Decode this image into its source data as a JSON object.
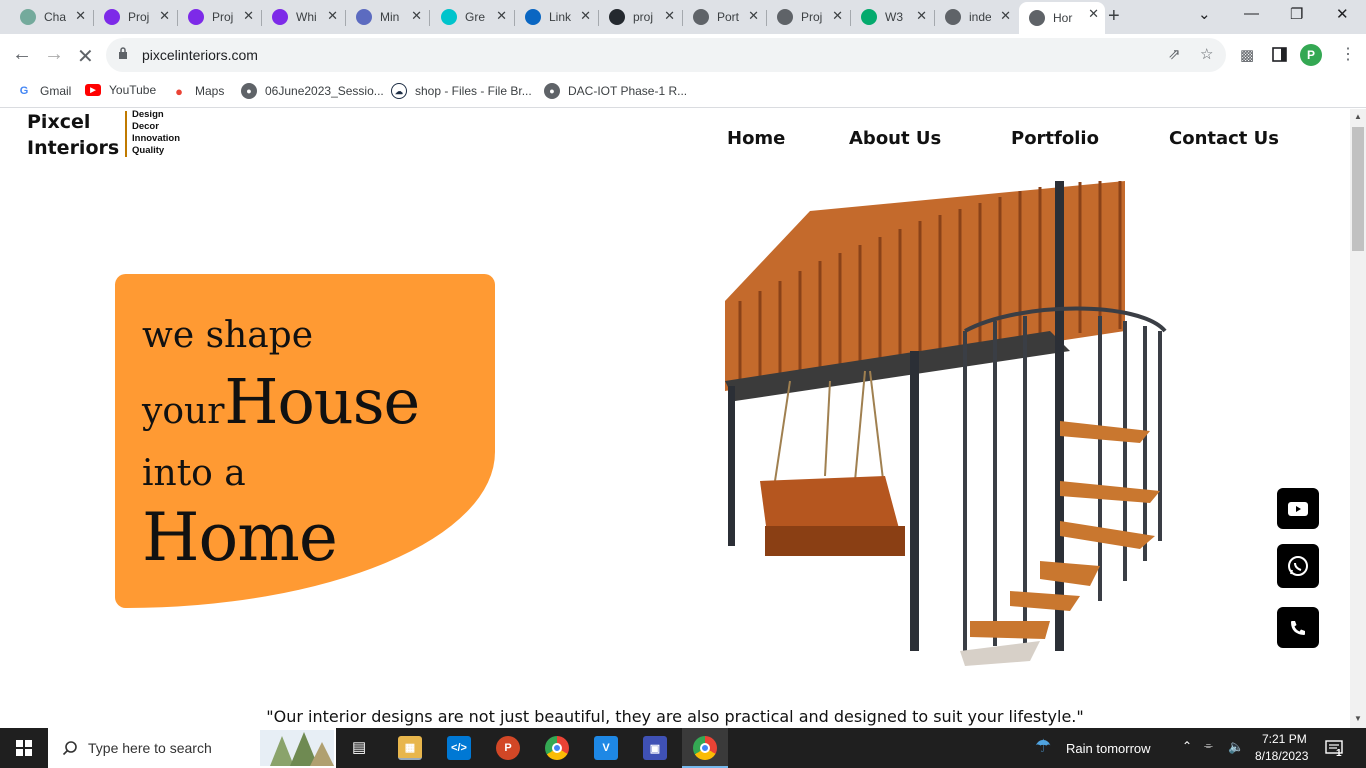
{
  "browser": {
    "tabs": [
      {
        "label": "Cha",
        "icon": "chatgpt-icon",
        "color": "#74aa9c"
      },
      {
        "label": "Proj",
        "icon": "canva-icon",
        "color": "#7d2ae8"
      },
      {
        "label": "Proj",
        "icon": "canva-icon",
        "color": "#7d2ae8"
      },
      {
        "label": "Whi",
        "icon": "canva-icon",
        "color": "#7d2ae8"
      },
      {
        "label": "Min",
        "icon": "printer-icon",
        "color": "#5c6bc0"
      },
      {
        "label": "Gre",
        "icon": "canva-icon",
        "color": "#00c4cc"
      },
      {
        "label": "Link",
        "icon": "linkedin-icon",
        "color": "#0a66c2"
      },
      {
        "label": "proj",
        "icon": "github-icon",
        "color": "#24292f"
      },
      {
        "label": "Port",
        "icon": "globe-icon",
        "color": "#5f6368"
      },
      {
        "label": "Proj",
        "icon": "globe-icon",
        "color": "#5f6368"
      },
      {
        "label": "W3",
        "icon": "w3schools-icon",
        "color": "#04aa6d"
      },
      {
        "label": "inde",
        "icon": "globe-icon",
        "color": "#5f6368"
      },
      {
        "label": "Hor",
        "icon": "loading-icon",
        "color": "#5f6368"
      }
    ],
    "url": "pixcelinteriors.com",
    "profile_initial": "P",
    "bookmarks": [
      {
        "label": "Gmail",
        "icon": "google-icon"
      },
      {
        "label": "YouTube",
        "icon": "youtube-icon"
      },
      {
        "label": "Maps",
        "icon": "maps-icon"
      },
      {
        "label": "06June2023_Sessio...",
        "icon": "globe-icon"
      },
      {
        "label": "shop - Files - File Br...",
        "icon": "owncloud-icon"
      },
      {
        "label": "DAC-IOT Phase-1 R...",
        "icon": "globe-icon"
      }
    ]
  },
  "site": {
    "logo": {
      "line1": "Pixcel",
      "line2": "Interiors",
      "tags": [
        "Design",
        "Decor",
        "Innovation",
        "Quality"
      ]
    },
    "nav": [
      "Home",
      "About Us",
      "Portfolio",
      "Contact Us"
    ],
    "hero": {
      "line1": "we shape",
      "line2_small": "your",
      "line2_big": "House",
      "line3": "into a",
      "line4": "Home"
    },
    "quote": "\"Our interior designs are not just beautiful, they are also practical and designed to suit your lifestyle.\"",
    "accent_color": "#ff9a33",
    "social": [
      "youtube-icon",
      "whatsapp-icon",
      "phone-icon"
    ]
  },
  "taskbar": {
    "search_placeholder": "Type here to search",
    "weather": "Rain tomorrow",
    "time": "7:21 PM",
    "date": "8/18/2023",
    "notification_count": "1"
  }
}
